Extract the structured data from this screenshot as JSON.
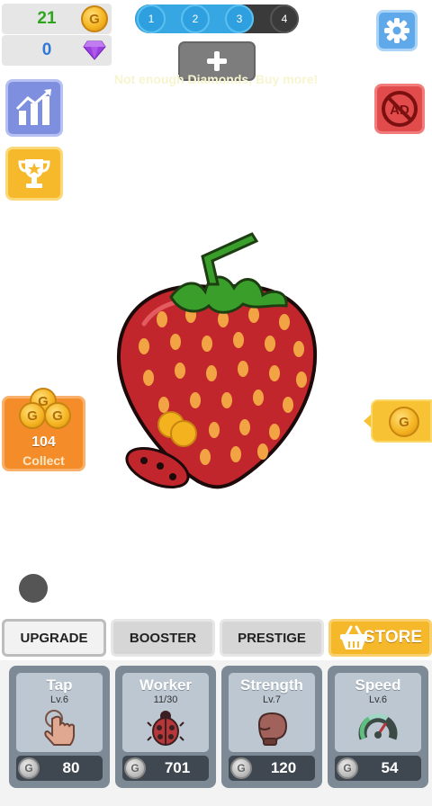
{
  "currency": {
    "gold": "21",
    "gold_icon": "G",
    "gems": "0"
  },
  "levels": {
    "nodes": [
      "1",
      "2",
      "3",
      "4"
    ],
    "completed": 3,
    "current": "4"
  },
  "faint_text": "Not enough Diamonds, Buy more!",
  "collect": {
    "amount": "104",
    "label": "Collect",
    "coin_icon": "G"
  },
  "side_coin": "G",
  "tabs": [
    {
      "label": "UPGRADE",
      "active": true
    },
    {
      "label": "BOOSTER",
      "active": false
    },
    {
      "label": "PRESTIGE",
      "active": false
    },
    {
      "label": "STORE",
      "active": false
    }
  ],
  "cards": [
    {
      "title": "Tap",
      "sub": "Lv.6",
      "icon": "tap-hand-icon",
      "price": "80",
      "coin": "G"
    },
    {
      "title": "Worker",
      "sub": "11/30",
      "icon": "ladybug-icon",
      "price": "701",
      "coin": "G"
    },
    {
      "title": "Strength",
      "sub": "Lv.7",
      "icon": "boxing-glove-icon",
      "price": "120",
      "coin": "G"
    },
    {
      "title": "Speed",
      "sub": "Lv.6",
      "icon": "speedometer-icon",
      "price": "54",
      "coin": "G"
    }
  ],
  "colors": {
    "gold_text": "#2fa51e",
    "gem_text": "#2f79d6",
    "progress": "#37a7e3",
    "store_tab": "#f5b82a",
    "collect_button": "#f48d29",
    "card_bg": "#7d8a96"
  }
}
